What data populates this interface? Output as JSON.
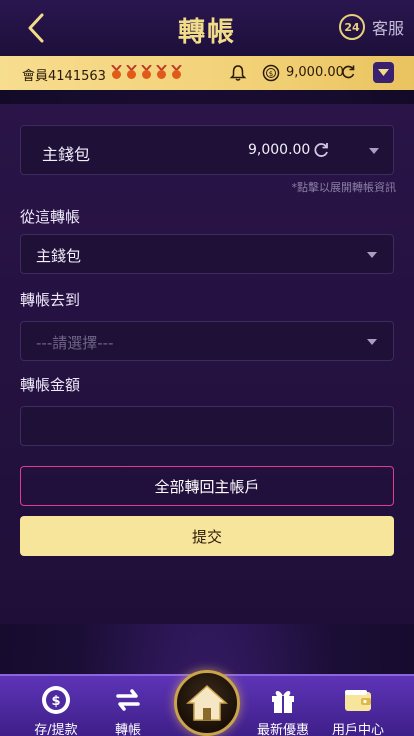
{
  "header": {
    "title": "轉帳",
    "support_label": "客服",
    "support_badge": "24"
  },
  "member": {
    "id_label": "會員4141563",
    "balance": "9,000.00"
  },
  "wallet": {
    "name": "主錢包",
    "amount": "9,000.00",
    "hint": "*點擊以展開轉帳資訊"
  },
  "form": {
    "from_label": "從這轉帳",
    "from_value": "主錢包",
    "to_label": "轉帳去到",
    "to_placeholder": "---請選擇---",
    "amount_label": "轉帳金額",
    "amount_value": ""
  },
  "buttons": {
    "transfer_all": "全部轉回主帳戶",
    "submit": "提交"
  },
  "nav": {
    "items": [
      {
        "label": "存/提款"
      },
      {
        "label": "轉帳"
      },
      {
        "label": "最新優惠"
      },
      {
        "label": "用戶中心"
      }
    ]
  },
  "colors": {
    "accent_gold": "#f1dc8a",
    "member_bar": "#f2d177",
    "outline_button": "#e03c8f",
    "submit_button": "#f6e59a",
    "nav_bar": "#4e2aa0"
  }
}
